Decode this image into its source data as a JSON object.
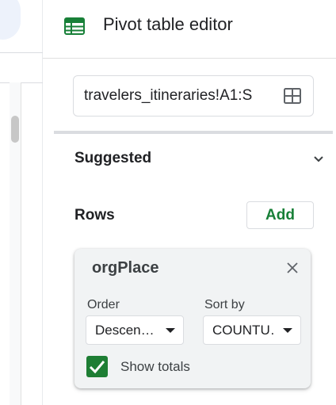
{
  "panel": {
    "title": "Pivot table editor",
    "range_value": "travelers_itineraries!A1:S",
    "suggested_label": "Suggested",
    "rows_label": "Rows",
    "add_label": "Add"
  },
  "row_card": {
    "field_name": "orgPlace",
    "order_label": "Order",
    "order_value": "Descen…",
    "sortby_label": "Sort by",
    "sortby_value": "COUNTU…",
    "show_totals_label": "Show totals",
    "show_totals_checked": true
  },
  "icons": {
    "title_icon": "sheets-table-icon",
    "range_icon": "grid-select-icon",
    "suggested_icon": "chevron-down-icon",
    "card_close_icon": "close-icon",
    "checkbox_icon": "check-icon"
  },
  "colors": {
    "accent_green": "#188038",
    "checkbox_green": "#1e7e34",
    "card_bg": "#f1f3f4",
    "border": "#dadce0"
  }
}
